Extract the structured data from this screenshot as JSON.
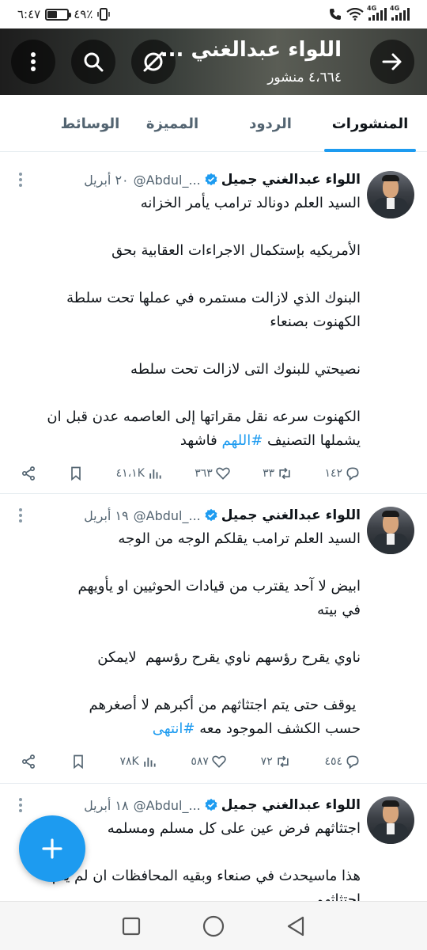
{
  "status_bar": {
    "time": "٦:٤٧",
    "battery_percent": "٤٩٪",
    "battery_level": 0.49,
    "network_1": "4G",
    "network_2": "4G"
  },
  "header": {
    "title": "اللواء عبدالغني ...",
    "subtitle": "٤،٦٦٤ منشور"
  },
  "tabs": [
    {
      "label": "المنشورات",
      "active": true
    },
    {
      "label": "الردود",
      "active": false
    },
    {
      "label": "المميزة",
      "active": false
    },
    {
      "label": "الوسائط",
      "active": false
    }
  ],
  "posts": [
    {
      "name": "اللواء عبدالغني جميل",
      "handle": "@Abdul_...",
      "date": "٢٠ أبريل",
      "body": "السيد العلم دونالد ترامب يأمر الخزانه\n\nالأمريكيه بإستكمال الاجراءات العقابية بحق\n\nالبنوك الذي لازالت مستمره في عملها تحت سلطة\nالكهنوت بصنعاء\n\nنصيحتي للبنوك التى لازالت تحت سلطه\n\nالكهنوت سرعه نقل مقراتها إلى العاصمه عدن قبل ان\nيشملها التصنيف ",
      "hashtag": "#اللهم",
      "body_end": " فاشهد",
      "replies": "١٤٢",
      "retweets": "٣٣",
      "likes": "٣٦٣",
      "views": "٤١،١K"
    },
    {
      "name": "اللواء عبدالغني جميل",
      "handle": "@Abdul_...",
      "date": "١٩ أبريل",
      "body": "السيد العلم ترامب يقلكم الوجه من الوجه\n\nابيض لا آحد يقترب من قيادات الحوثيين او يأويهم\nفي بيته\n\nناوي يقرح رؤسهم ناوي يقرح رؤسهم  لايمكن\n\n يوقف حتى يتم اجتثاثهم من أكبرهم لا أصغرهم\nحسب الكشف الموجود معه ",
      "hashtag": "#انتهى",
      "body_end": "",
      "replies": "٤٥٤",
      "retweets": "٧٢",
      "likes": "٥٨٧",
      "views": "٧٨K"
    },
    {
      "name": "اللواء عبدالغني جميل",
      "handle": "@Abdul_...",
      "date": "١٨ أبريل",
      "body": "اجتثاثهم فرض عين على كل مسلم ومسلمه\n\nهذا ماسيحدث في صنعاء وبقيه المحافظات ان لم يتم\nاجتثاثهم",
      "hashtag": "",
      "body_end": ""
    }
  ]
}
